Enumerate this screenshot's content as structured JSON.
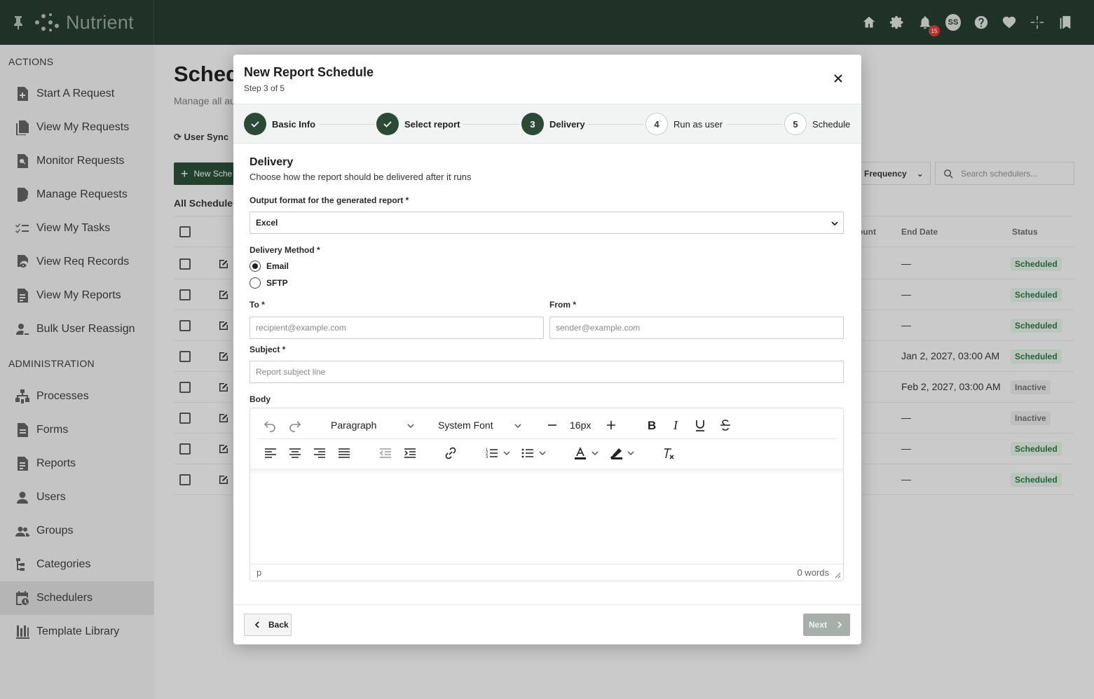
{
  "app": {
    "name": "Nutrient",
    "notification_count": "15",
    "avatar_initials": "SS"
  },
  "sidebar": {
    "actions_heading": "ACTIONS",
    "actions": [
      {
        "label": "Start A Request"
      },
      {
        "label": "View My Requests"
      },
      {
        "label": "Monitor Requests"
      },
      {
        "label": "Manage Requests"
      },
      {
        "label": "View My Tasks"
      },
      {
        "label": "View Req Records"
      },
      {
        "label": "View My Reports"
      },
      {
        "label": "Bulk User Reassign"
      }
    ],
    "admin_heading": "ADMINISTRATION",
    "admin": [
      {
        "label": "Processes"
      },
      {
        "label": "Forms"
      },
      {
        "label": "Reports"
      },
      {
        "label": "Users"
      },
      {
        "label": "Groups"
      },
      {
        "label": "Categories"
      },
      {
        "label": "Schedulers"
      },
      {
        "label": "Template Library"
      }
    ]
  },
  "background": {
    "title": "Sched",
    "subtitle": "Manage all au",
    "user_sync": "User Sync",
    "new_button": "New Sche",
    "list_title": "All Schedulers",
    "frequency_filter": "ll Frequency",
    "search_placeholder": "Search schedulers...",
    "columns": {
      "count": "ount",
      "end_date": "End Date",
      "status": "Status"
    },
    "rows": [
      {
        "end_date": "—",
        "status": "Scheduled"
      },
      {
        "end_date": "—",
        "status": "Scheduled"
      },
      {
        "end_date": "—",
        "status": "Scheduled"
      },
      {
        "end_date": "Jan 2, 2027, 03:00 AM",
        "status": "Scheduled"
      },
      {
        "end_date": "Feb 2, 2027, 03:00 AM",
        "status": "Inactive"
      },
      {
        "end_date": "—",
        "status": "Inactive"
      },
      {
        "end_date": "—",
        "status": "Scheduled"
      },
      {
        "end_date": "—",
        "status": "Scheduled"
      }
    ]
  },
  "modal": {
    "title": "New Report Schedule",
    "step_indicator": "Step 3 of 5",
    "steps": [
      {
        "number": "1",
        "label": "Basic Info",
        "state": "done"
      },
      {
        "number": "2",
        "label": "Select report",
        "state": "done"
      },
      {
        "number": "3",
        "label": "Delivery",
        "state": "current"
      },
      {
        "number": "4",
        "label": "Run as user",
        "state": "todo"
      },
      {
        "number": "5",
        "label": "Schedule",
        "state": "todo"
      }
    ],
    "section_title": "Delivery",
    "section_desc": "Choose how the report should be delivered after it runs",
    "output_format": {
      "label": "Output format for the generated report *",
      "value": "Excel"
    },
    "delivery_method": {
      "label": "Delivery Method *",
      "options": [
        {
          "label": "Email",
          "selected": true
        },
        {
          "label": "SFTP",
          "selected": false
        }
      ]
    },
    "to": {
      "label": "To *",
      "placeholder": "recipient@example.com"
    },
    "from": {
      "label": "From *",
      "placeholder": "sender@example.com"
    },
    "subject": {
      "label": "Subject *",
      "placeholder": "Report subject line"
    },
    "body": {
      "label": "Body",
      "block_format": "Paragraph",
      "font_family": "System Font",
      "font_size": "16px",
      "path": "p",
      "word_count": "0 words"
    },
    "back_label": "Back",
    "next_label": "Next"
  }
}
